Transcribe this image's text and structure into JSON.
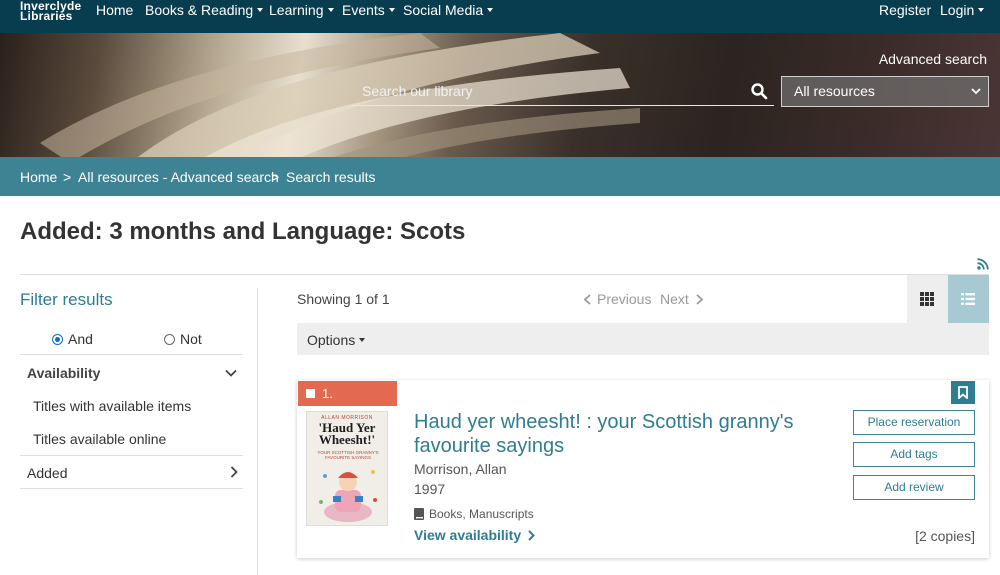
{
  "header": {
    "logo_line1": "Inverclyde",
    "logo_line2": "Libraries",
    "nav": {
      "home": "Home",
      "books_reading": "Books & Reading",
      "learning": "Learning",
      "events": "Events",
      "social_media": "Social Media",
      "register": "Register",
      "login": "Login"
    }
  },
  "search": {
    "advanced_search_label": "Advanced search",
    "placeholder": "Search our library",
    "scope_selected": "All resources"
  },
  "breadcrumb": {
    "home": "Home",
    "advanced": "All resources - Advanced search",
    "current": "Search results",
    "separator": ">"
  },
  "page_title": "Added: 3 months and Language: Scots",
  "sidebar": {
    "title": "Filter results",
    "and_label": "And",
    "not_label": "Not",
    "availability_label": "Availability",
    "available_items": "Titles with available items",
    "available_online": "Titles available online",
    "added_label": "Added"
  },
  "results_toolbar": {
    "showing": "Showing 1 of 1",
    "previous": "Previous",
    "next": "Next",
    "options": "Options"
  },
  "result": {
    "number": "1.",
    "title": "Haud yer wheesht! : your Scottish granny's favourite sayings",
    "author": "Morrison, Allan",
    "year": "1997",
    "format": "Books, Manuscripts",
    "availability_link": "View availability",
    "place_reservation": "Place reservation",
    "add_tags": "Add tags",
    "add_review": "Add review",
    "copies": "[2 copies]",
    "cover": {
      "author": "ALLAN MORRISON",
      "title_line1": "'Haud Yer",
      "title_line2": "Wheesht!'",
      "subtitle": "YOUR SCOTTISH GRANNY'S FAVOURITE SAYINGS"
    }
  },
  "colors": {
    "nav_bg": "#073d4e",
    "breadcrumb_bg": "#3d8393",
    "accent": "#2f7d91",
    "number_tag": "#e36a51",
    "list_view_active": "#a7c9d2"
  }
}
